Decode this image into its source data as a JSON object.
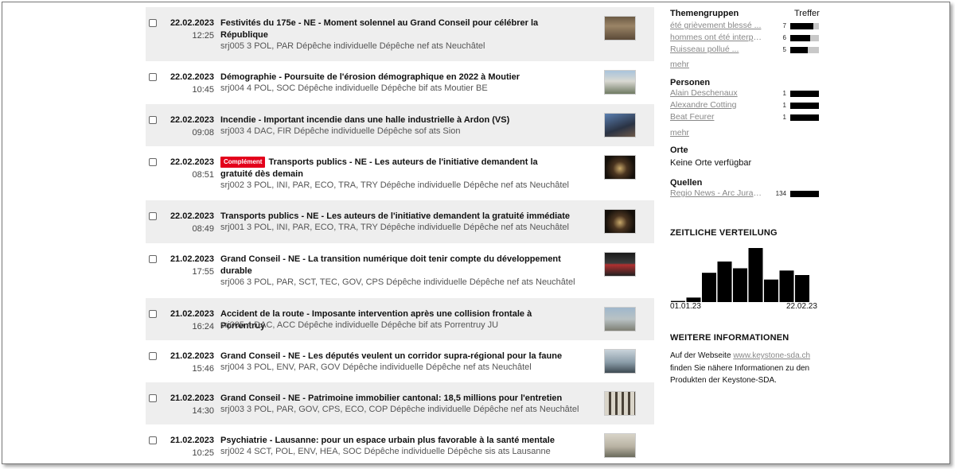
{
  "news": [
    {
      "date": "22.02.2023",
      "time": "12:25",
      "badge": "",
      "title": "Festivités du 175e - NE - Moment solennel au Grand Conseil pour célébrer la République",
      "meta": "srj005 3 POL, PAR Dépêche individuelle Dépêche nef ats Neuchâtel",
      "thumb": "parliament-photo"
    },
    {
      "date": "22.02.2023",
      "time": "10:45",
      "badge": "",
      "title": "Démographie - Poursuite de l'érosion démographique en 2022 à Moutier",
      "meta": "srj004 4 POL, SOC Dépêche individuelle Dépêche bif ats Moutier BE",
      "thumb": "building-photo"
    },
    {
      "date": "22.02.2023",
      "time": "09:08",
      "badge": "",
      "title": "Incendie - Important incendie dans une halle industrielle à Ardon (VS)",
      "meta": "srj003 4 DAC, FIR Dépêche individuelle Dépêche sof ats Sion",
      "thumb": "fire-photo"
    },
    {
      "date": "22.02.2023",
      "time": "08:51",
      "badge": "Complément",
      "title": "Transports publics - NE - Les auteurs de l'initiative demandent la gratuité dès demain",
      "meta": "srj002 3 POL, INI, PAR, ECO, TRA, TRY Dépêche individuelle Dépêche nef ats Neuchâtel",
      "thumb": "tunnel-photo"
    },
    {
      "date": "22.02.2023",
      "time": "08:49",
      "badge": "",
      "title": "Transports publics - NE - Les auteurs de l'initiative demandent la gratuité immédiate",
      "meta": "srj001 3 POL, INI, PAR, ECO, TRA, TRY Dépêche individuelle Dépêche nef ats Neuchâtel",
      "thumb": "tunnel-photo"
    },
    {
      "date": "21.02.2023",
      "time": "17:55",
      "badge": "",
      "title": "Grand Conseil - NE - La transition numérique doit tenir compte du développement durable",
      "meta": "srj006 3 POL, PAR, SCT, TEC, GOV, CPS Dépêche individuelle Dépêche nef ats Neuchâtel",
      "thumb": "screen-photo"
    },
    {
      "date": "21.02.2023",
      "time": "16:24",
      "badge": "",
      "title": "Accident de la route - Imposante intervention après une collision frontale à Porrentruy",
      "meta": "srj005 4 DAC, ACC Dépêche individuelle Dépêche bif ats Porrentruy JU",
      "thumb": "accident-photo"
    },
    {
      "date": "21.02.2023",
      "time": "15:46",
      "badge": "",
      "title": "Grand Conseil - NE - Les députés veulent un corridor supra-régional pour la faune",
      "meta": "srj004 3 POL, ENV, PAR, GOV Dépêche individuelle Dépêche nef ats Neuchâtel",
      "thumb": "lake-photo"
    },
    {
      "date": "21.02.2023",
      "time": "14:30",
      "badge": "",
      "title": "Grand Conseil - NE - Patrimoine immobilier cantonal: 18,5 millions pour l'entretien",
      "meta": "srj003 3 POL, PAR, GOV, CPS, ECO, COP Dépêche individuelle Dépêche nef ats Neuchâtel",
      "thumb": "columns-photo"
    },
    {
      "date": "21.02.2023",
      "time": "10:25",
      "badge": "",
      "title": "Psychiatrie - Lausanne: pour un espace urbain plus favorable à la santé mentale",
      "meta": "srj002 4 SCT, POL, ENV, HEA, SOC Dépêche individuelle Dépêche sis ats Lausanne",
      "thumb": "city-photo"
    }
  ],
  "sidebar": {
    "themengruppen": {
      "heading": "Themengruppen",
      "hits_label": "Treffer",
      "items": [
        {
          "label": "été grièvement blessé ...",
          "count": "7",
          "ratio": 0.8
        },
        {
          "label": "hommes ont été interpell...",
          "count": "6",
          "ratio": 0.7
        },
        {
          "label": "Ruisseau pollué ...",
          "count": "5",
          "ratio": 0.6
        }
      ],
      "more": "mehr"
    },
    "personen": {
      "heading": "Personen",
      "items": [
        {
          "label": "Alain Deschenaux",
          "count": "1",
          "ratio": 1
        },
        {
          "label": "Alexandre Cotting",
          "count": "1",
          "ratio": 1
        },
        {
          "label": "Beat Feurer",
          "count": "1",
          "ratio": 1
        }
      ],
      "more": "mehr"
    },
    "orte": {
      "heading": "Orte",
      "text": "Keine Orte verfügbar"
    },
    "quellen": {
      "heading": "Quellen",
      "items": [
        {
          "label": "Regio News - Arc Jurassi...",
          "count": "134",
          "ratio": 1
        }
      ]
    },
    "verteilung": {
      "heading": "ZEITLICHE VERTEILUNG",
      "start": "01.01.23",
      "end": "22.02.23"
    },
    "weitere": {
      "heading": "WEITERE INFORMATIONEN",
      "pre": "Auf der Webseite ",
      "link": "www.keystone-sda.ch",
      "post": " finden Sie nähere Informationen zu den Produkten der Keystone-SDA."
    }
  },
  "chart_data": {
    "type": "bar",
    "title": "ZEITLICHE VERTEILUNG",
    "xlabel": "",
    "ylabel": "",
    "x_start": "01.01.23",
    "x_end": "22.02.23",
    "values": [
      0.5,
      2,
      13,
      18,
      15,
      24,
      10,
      14,
      12
    ],
    "ylim": [
      0,
      24
    ]
  }
}
